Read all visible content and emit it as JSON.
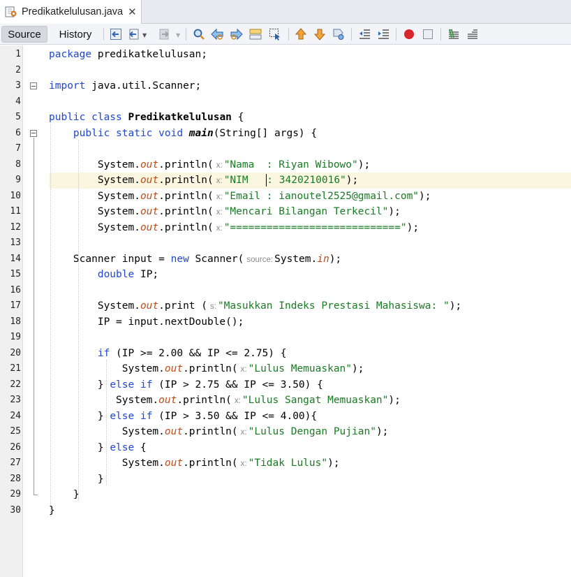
{
  "tab": {
    "title": "Predikatkelulusan.java",
    "close": "✕"
  },
  "toolbar": {
    "source_label": "Source",
    "history_label": "History",
    "icons": [
      "last-edit-icon",
      "back-icon",
      "forward-icon",
      "find-icon",
      "find-previous-icon",
      "find-next-icon",
      "toggle-highlight-icon",
      "find-selection-icon",
      "previous-bookmark-icon",
      "next-bookmark-icon",
      "toggle-bookmark-icon",
      "shift-left-icon",
      "shift-right-icon",
      "record-macro-icon",
      "stop-macro-icon",
      "comment-icon",
      "uncomment-icon"
    ]
  },
  "editor": {
    "highlighted_line": 9,
    "lines": [
      {
        "n": "1",
        "tokens": [
          {
            "c": "kw",
            "t": "package"
          },
          {
            "c": "",
            "t": " predikatkelulusan;"
          }
        ]
      },
      {
        "n": "2",
        "tokens": []
      },
      {
        "n": "3",
        "tokens": [
          {
            "c": "kw",
            "t": "import"
          },
          {
            "c": "",
            "t": " java.util.Scanner;"
          }
        ]
      },
      {
        "n": "4",
        "tokens": []
      },
      {
        "n": "5",
        "tokens": [
          {
            "c": "kw",
            "t": "public class"
          },
          {
            "c": "",
            "t": " "
          },
          {
            "c": "bold",
            "t": "Predikatkelulusan"
          },
          {
            "c": "",
            "t": " {"
          }
        ]
      },
      {
        "n": "6",
        "tokens": [
          {
            "c": "",
            "t": "    "
          },
          {
            "c": "kw",
            "t": "public static void"
          },
          {
            "c": "",
            "t": " "
          },
          {
            "c": "bold-italic",
            "t": "main"
          },
          {
            "c": "",
            "t": "(String[] args) {"
          }
        ]
      },
      {
        "n": "7",
        "tokens": []
      },
      {
        "n": "8",
        "tokens": [
          {
            "c": "",
            "t": "        System."
          },
          {
            "c": "fld",
            "t": "out"
          },
          {
            "c": "",
            "t": ".println("
          },
          {
            "c": "hint",
            "t": "x:"
          },
          {
            "c": "str",
            "t": "\"Nama  : Riyan Wibowo\""
          },
          {
            "c": "",
            "t": ");"
          }
        ]
      },
      {
        "n": "9",
        "tokens": [
          {
            "c": "",
            "t": "        System."
          },
          {
            "c": "fld",
            "t": "out"
          },
          {
            "c": "",
            "t": ".println("
          },
          {
            "c": "hint",
            "t": "x:"
          },
          {
            "c": "str",
            "t": "\"NIM   "
          },
          {
            "c": "caret",
            "t": ""
          },
          {
            "c": "str",
            "t": ": 3420210016\""
          },
          {
            "c": "",
            "t": ");"
          }
        ]
      },
      {
        "n": "10",
        "tokens": [
          {
            "c": "",
            "t": "        System."
          },
          {
            "c": "fld",
            "t": "out"
          },
          {
            "c": "",
            "t": ".println("
          },
          {
            "c": "hint",
            "t": "x:"
          },
          {
            "c": "str",
            "t": "\"Email : ianoutel2525@gmail.com\""
          },
          {
            "c": "",
            "t": ");"
          }
        ]
      },
      {
        "n": "11",
        "tokens": [
          {
            "c": "",
            "t": "        System."
          },
          {
            "c": "fld",
            "t": "out"
          },
          {
            "c": "",
            "t": ".println("
          },
          {
            "c": "hint",
            "t": "x:"
          },
          {
            "c": "str",
            "t": "\"Mencari Bilangan Terkecil\""
          },
          {
            "c": "",
            "t": ");"
          }
        ]
      },
      {
        "n": "12",
        "tokens": [
          {
            "c": "",
            "t": "        System."
          },
          {
            "c": "fld",
            "t": "out"
          },
          {
            "c": "",
            "t": ".println("
          },
          {
            "c": "hint",
            "t": "x:"
          },
          {
            "c": "str",
            "t": "\"============================\""
          },
          {
            "c": "",
            "t": ");"
          }
        ]
      },
      {
        "n": "13",
        "tokens": []
      },
      {
        "n": "14",
        "tokens": [
          {
            "c": "",
            "t": "    Scanner input = "
          },
          {
            "c": "kw",
            "t": "new"
          },
          {
            "c": "",
            "t": " Scanner("
          },
          {
            "c": "hint",
            "t": "source:"
          },
          {
            "c": "",
            "t": "System."
          },
          {
            "c": "fld",
            "t": "in"
          },
          {
            "c": "",
            "t": ");"
          }
        ]
      },
      {
        "n": "15",
        "tokens": [
          {
            "c": "",
            "t": "        "
          },
          {
            "c": "kw",
            "t": "double"
          },
          {
            "c": "",
            "t": " IP;"
          }
        ]
      },
      {
        "n": "16",
        "tokens": []
      },
      {
        "n": "17",
        "tokens": [
          {
            "c": "",
            "t": "        System."
          },
          {
            "c": "fld",
            "t": "out"
          },
          {
            "c": "",
            "t": ".print ("
          },
          {
            "c": "hint",
            "t": "s:"
          },
          {
            "c": "str",
            "t": "\"Masukkan Indeks Prestasi Mahasiswa: \""
          },
          {
            "c": "",
            "t": ");"
          }
        ]
      },
      {
        "n": "18",
        "tokens": [
          {
            "c": "",
            "t": "        IP = input.nextDouble();"
          }
        ]
      },
      {
        "n": "19",
        "tokens": []
      },
      {
        "n": "20",
        "tokens": [
          {
            "c": "",
            "t": "        "
          },
          {
            "c": "kw",
            "t": "if"
          },
          {
            "c": "",
            "t": " (IP >= 2.00 && IP <= 2.75) {"
          }
        ]
      },
      {
        "n": "21",
        "tokens": [
          {
            "c": "",
            "t": "            System."
          },
          {
            "c": "fld",
            "t": "out"
          },
          {
            "c": "",
            "t": ".println("
          },
          {
            "c": "hint",
            "t": "x:"
          },
          {
            "c": "str",
            "t": "\"Lulus Memuaskan\""
          },
          {
            "c": "",
            "t": ");"
          }
        ]
      },
      {
        "n": "22",
        "tokens": [
          {
            "c": "",
            "t": "        } "
          },
          {
            "c": "kw",
            "t": "else if"
          },
          {
            "c": "",
            "t": " (IP > 2.75 && IP <= 3.50) {"
          }
        ]
      },
      {
        "n": "23",
        "tokens": [
          {
            "c": "",
            "t": "           System."
          },
          {
            "c": "fld",
            "t": "out"
          },
          {
            "c": "",
            "t": ".println("
          },
          {
            "c": "hint",
            "t": "x:"
          },
          {
            "c": "str",
            "t": "\"Lulus Sangat Memuaskan\""
          },
          {
            "c": "",
            "t": ");"
          }
        ]
      },
      {
        "n": "24",
        "tokens": [
          {
            "c": "",
            "t": "        } "
          },
          {
            "c": "kw",
            "t": "else if"
          },
          {
            "c": "",
            "t": " (IP > 3.50 && IP <= 4.00){"
          }
        ]
      },
      {
        "n": "25",
        "tokens": [
          {
            "c": "",
            "t": "            System."
          },
          {
            "c": "fld",
            "t": "out"
          },
          {
            "c": "",
            "t": ".println("
          },
          {
            "c": "hint",
            "t": "x:"
          },
          {
            "c": "str",
            "t": "\"Lulus Dengan Pujian\""
          },
          {
            "c": "",
            "t": ");"
          }
        ]
      },
      {
        "n": "26",
        "tokens": [
          {
            "c": "",
            "t": "        } "
          },
          {
            "c": "kw",
            "t": "else"
          },
          {
            "c": "",
            "t": " {"
          }
        ]
      },
      {
        "n": "27",
        "tokens": [
          {
            "c": "",
            "t": "            System."
          },
          {
            "c": "fld",
            "t": "out"
          },
          {
            "c": "",
            "t": ".println("
          },
          {
            "c": "hint",
            "t": "x:"
          },
          {
            "c": "str",
            "t": "\"Tidak Lulus\""
          },
          {
            "c": "",
            "t": ");"
          }
        ]
      },
      {
        "n": "28",
        "tokens": [
          {
            "c": "",
            "t": "        }"
          }
        ]
      },
      {
        "n": "29",
        "tokens": [
          {
            "c": "",
            "t": "    }"
          }
        ]
      },
      {
        "n": "30",
        "tokens": [
          {
            "c": "",
            "t": "}"
          }
        ]
      }
    ]
  }
}
